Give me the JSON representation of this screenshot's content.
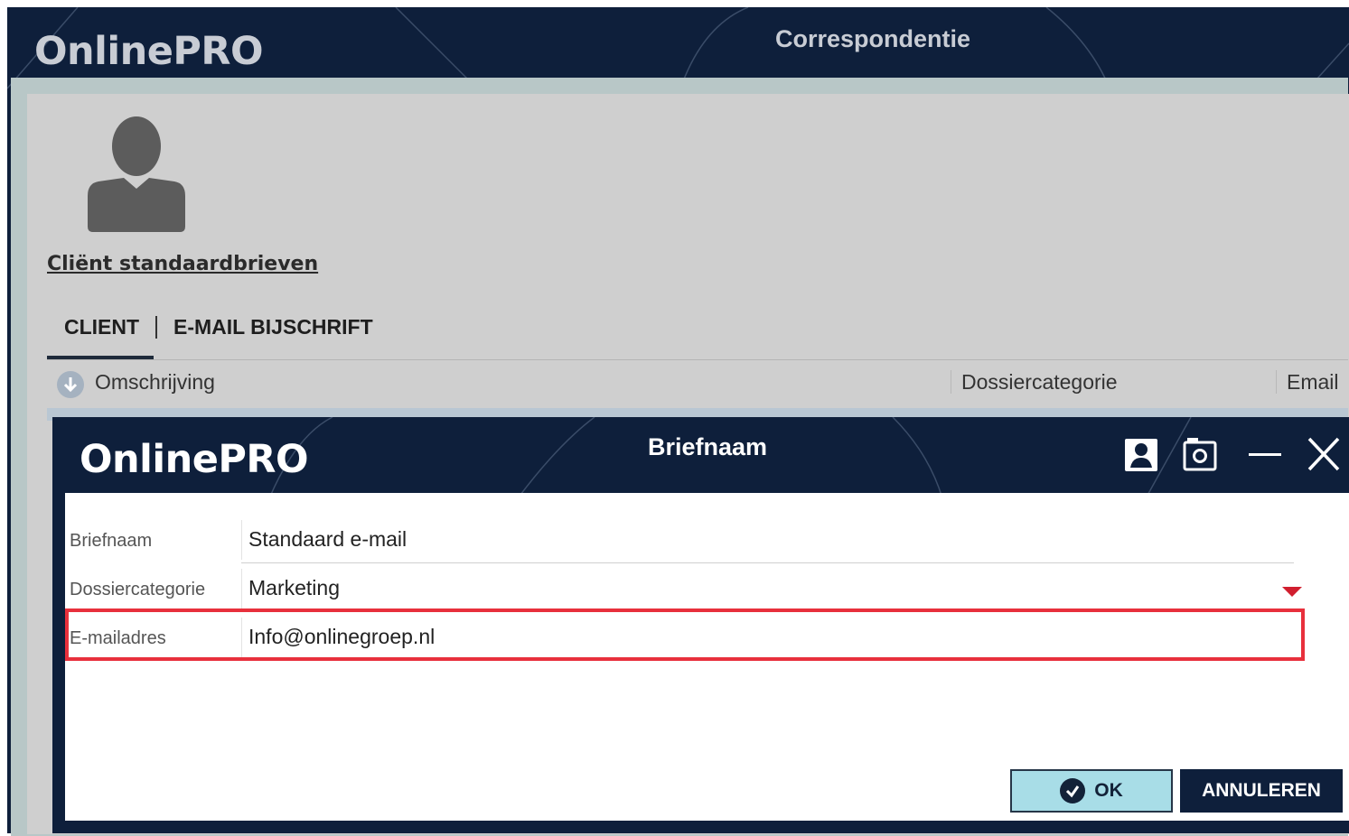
{
  "app": {
    "logo": "OnlinePRO",
    "title": "Correspondentie"
  },
  "client": {
    "link_label": "Cliënt standaardbrieven",
    "tabs": [
      "CLIENT",
      "E-MAIL BIJSCHRIFT"
    ],
    "active_tab": "CLIENT"
  },
  "grid": {
    "columns": [
      "Omschrijving",
      "Dossiercategorie",
      "Email"
    ]
  },
  "dialog": {
    "logo": "OnlinePRO",
    "title": "Briefnaam",
    "window_buttons": [
      "user-icon",
      "screenshot-icon",
      "minimize-icon",
      "close-icon"
    ],
    "fields": [
      {
        "label": "Briefnaam",
        "value": "Standaard e-mail"
      },
      {
        "label": "Dossiercategorie",
        "value": "Marketing"
      },
      {
        "label": "E-mailadres",
        "value": "Info@onlinegroep.nl"
      }
    ],
    "ok_label": "OK",
    "cancel_label": "ANNULEREN"
  },
  "colors": {
    "navy": "#0e1f3b",
    "ok_button": "#a8dde7",
    "highlight": "#e8303c",
    "dropdown_arrow": "#d11f2f"
  }
}
